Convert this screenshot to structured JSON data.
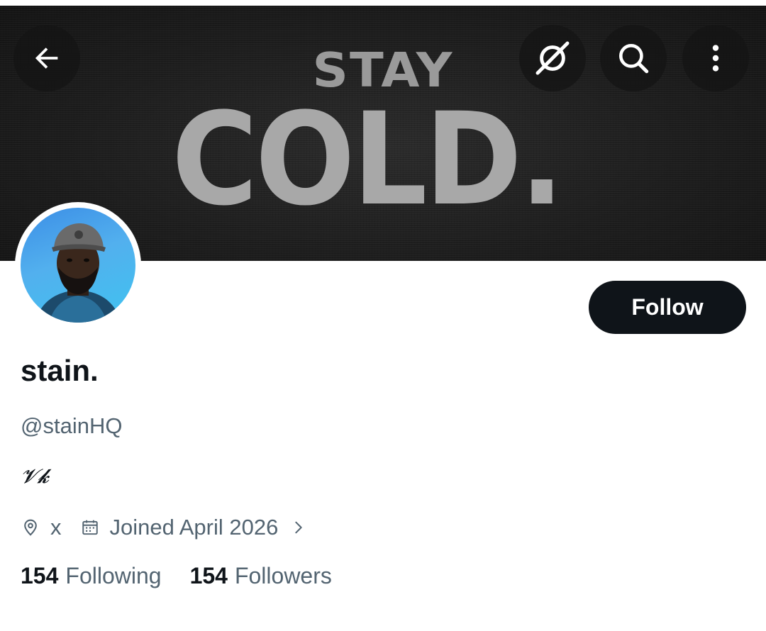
{
  "banner": {
    "line1": "STAY",
    "line2": "COLD."
  },
  "header": {
    "back_icon": "arrow-left-icon",
    "grok_icon": "grok-slash-circle-icon",
    "search_icon": "search-icon",
    "more_icon": "more-vertical-icon"
  },
  "profile": {
    "display_name": "stain.",
    "handle": "@stainHQ",
    "bio": "𝓥𝓴",
    "location": "x",
    "joined": "Joined April 2026",
    "follow_label": "Follow"
  },
  "stats": {
    "following_count": "154",
    "following_label": "Following",
    "followers_count": "154",
    "followers_label": "Followers"
  },
  "colors": {
    "primary_text": "#0f1419",
    "secondary_text": "#536471",
    "follow_bg": "#0f1419"
  }
}
